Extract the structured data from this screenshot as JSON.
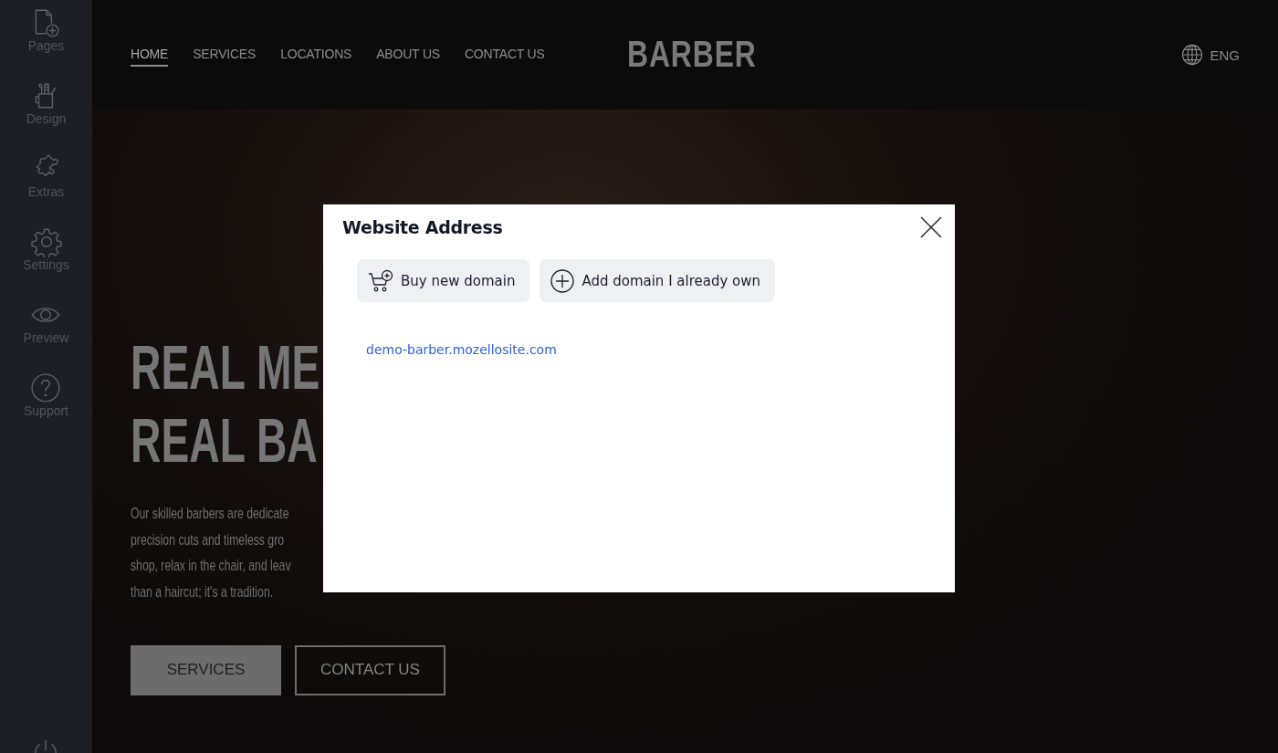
{
  "sidebar": {
    "items": [
      {
        "label": "Pages"
      },
      {
        "label": "Design"
      },
      {
        "label": "Extras"
      },
      {
        "label": "Settings"
      },
      {
        "label": "Preview"
      },
      {
        "label": "Support"
      }
    ]
  },
  "nav": {
    "items": [
      {
        "label": "HOME",
        "selected": true
      },
      {
        "label": "SERVICES",
        "selected": false
      },
      {
        "label": "LOCATIONS",
        "selected": false
      },
      {
        "label": "ABOUT US",
        "selected": false
      },
      {
        "label": "CONTACT US",
        "selected": false
      }
    ]
  },
  "logo": "BARBER",
  "language": "ENG",
  "hero": {
    "heading_lines": [
      "REAL ME",
      "REAL BA"
    ],
    "paragraph_lines": [
      "Our skilled barbers are dedicate",
      "precision cuts and timeless gro",
      "shop, relax in the chair, and leav",
      "than a haircut; it's a tradition."
    ],
    "buttons": [
      {
        "label": "SERVICES",
        "kind": "filled"
      },
      {
        "label": "CONTACT US",
        "kind": "outline"
      }
    ]
  },
  "dialog": {
    "title": "Website Address",
    "actions": [
      {
        "label": "Buy new domain"
      },
      {
        "label": "Add domain I already own"
      }
    ],
    "address": "demo-barber.mozellosite.com"
  }
}
